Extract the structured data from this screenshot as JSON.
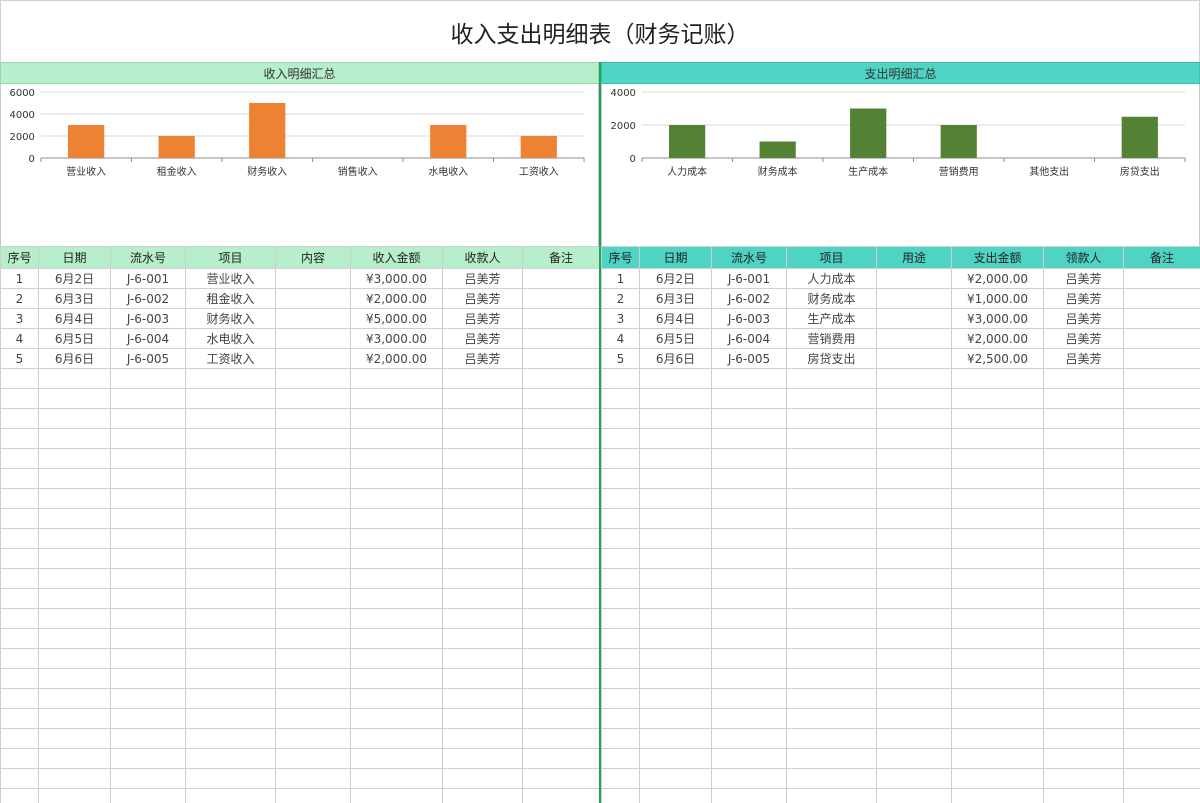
{
  "title": "收入支出明细表（财务记账）",
  "colors": {
    "income_bar": "#ee8233",
    "expense_bar": "#548235",
    "income_header": "#b7eecb",
    "expense_header": "#4fd3c3",
    "divider": "#1fa35a"
  },
  "income": {
    "header": "收入明细汇总",
    "columns": [
      "序号",
      "日期",
      "流水号",
      "项目",
      "内容",
      "收入金额",
      "收款人",
      "备注"
    ],
    "rows": [
      [
        "1",
        "6月2日",
        "J-6-001",
        "营业收入",
        "",
        "¥3,000.00",
        "吕美芳",
        ""
      ],
      [
        "2",
        "6月3日",
        "J-6-002",
        "租金收入",
        "",
        "¥2,000.00",
        "吕美芳",
        ""
      ],
      [
        "3",
        "6月4日",
        "J-6-003",
        "财务收入",
        "",
        "¥5,000.00",
        "吕美芳",
        ""
      ],
      [
        "4",
        "6月5日",
        "J-6-004",
        "水电收入",
        "",
        "¥3,000.00",
        "吕美芳",
        ""
      ],
      [
        "5",
        "6月6日",
        "J-6-005",
        "工资收入",
        "",
        "¥2,000.00",
        "吕美芳",
        ""
      ]
    ]
  },
  "expense": {
    "header": "支出明细汇总",
    "columns": [
      "序号",
      "日期",
      "流水号",
      "项目",
      "用途",
      "支出金额",
      "领款人",
      "备注"
    ],
    "rows": [
      [
        "1",
        "6月2日",
        "J-6-001",
        "人力成本",
        "",
        "¥2,000.00",
        "吕美芳",
        ""
      ],
      [
        "2",
        "6月3日",
        "J-6-002",
        "财务成本",
        "",
        "¥1,000.00",
        "吕美芳",
        ""
      ],
      [
        "3",
        "6月4日",
        "J-6-003",
        "生产成本",
        "",
        "¥3,000.00",
        "吕美芳",
        ""
      ],
      [
        "4",
        "6月5日",
        "J-6-004",
        "营销费用",
        "",
        "¥2,000.00",
        "吕美芳",
        ""
      ],
      [
        "5",
        "6月6日",
        "J-6-005",
        "房贷支出",
        "",
        "¥2,500.00",
        "吕美芳",
        ""
      ]
    ]
  },
  "chart_data": [
    {
      "type": "bar",
      "categories": [
        "营业收入",
        "租金收入",
        "财务收入",
        "销售收入",
        "水电收入",
        "工资收入"
      ],
      "values": [
        3000,
        2000,
        5000,
        0,
        3000,
        2000
      ],
      "yticks": [
        0,
        2000,
        4000,
        6000
      ],
      "ylim": [
        0,
        6000
      ],
      "grid": true,
      "legend": "none"
    },
    {
      "type": "bar",
      "categories": [
        "人力成本",
        "财务成本",
        "生产成本",
        "营销费用",
        "其他支出",
        "房贷支出"
      ],
      "values": [
        2000,
        1000,
        3000,
        2000,
        0,
        2500
      ],
      "yticks": [
        0,
        2000,
        4000
      ],
      "ylim": [
        0,
        4000
      ],
      "grid": true,
      "legend": "none"
    }
  ]
}
